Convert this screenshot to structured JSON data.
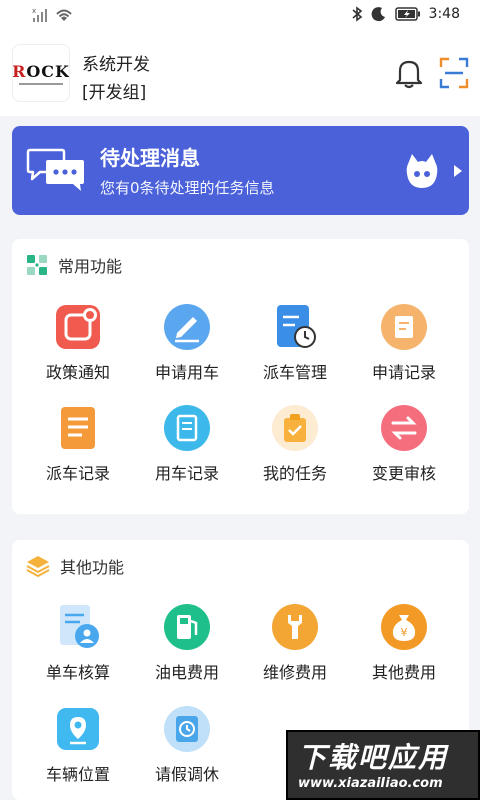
{
  "status_bar": {
    "time": "3:48",
    "icons": [
      "no-sim-icon",
      "wifi-icon",
      "bluetooth-icon",
      "moon-icon",
      "battery-icon"
    ]
  },
  "header": {
    "avatar_logo_text": "ROCK",
    "user_name": "系统开发",
    "user_group": "[开发组]",
    "icons": [
      "bell-icon",
      "scan-icon"
    ]
  },
  "banner": {
    "title": "待处理消息",
    "subtitle": "您有0条待处理的任务信息",
    "color": "#4a61d9"
  },
  "common": {
    "title": "常用功能",
    "items": [
      {
        "label": "政策通知",
        "icon": "policy-notice-icon",
        "color": "#f05a4f"
      },
      {
        "label": "申请用车",
        "icon": "apply-car-icon",
        "color": "#5aa7f0"
      },
      {
        "label": "派车管理",
        "icon": "dispatch-manage-icon",
        "color": "#3a8ee6"
      },
      {
        "label": "申请记录",
        "icon": "apply-record-icon",
        "color": "#f6b36b"
      },
      {
        "label": "派车记录",
        "icon": "dispatch-record-icon",
        "color": "#f59a3a"
      },
      {
        "label": "用车记录",
        "icon": "car-record-icon",
        "color": "#3db8ea"
      },
      {
        "label": "我的任务",
        "icon": "my-task-icon",
        "color": "#f7b13c"
      },
      {
        "label": "变更审核",
        "icon": "change-review-icon",
        "color": "#f56e7e"
      }
    ]
  },
  "other": {
    "title": "其他功能",
    "items": [
      {
        "label": "单车核算",
        "icon": "accounting-icon",
        "color": "#49a7ee"
      },
      {
        "label": "油电费用",
        "icon": "fuel-cost-icon",
        "color": "#1fbf8c"
      },
      {
        "label": "维修费用",
        "icon": "repair-cost-icon",
        "color": "#f3a634"
      },
      {
        "label": "其他费用",
        "icon": "other-cost-icon",
        "color": "#f39a26"
      },
      {
        "label": "车辆位置",
        "icon": "location-icon",
        "color": "#3fb9ef"
      },
      {
        "label": "请假调休",
        "icon": "leave-icon",
        "color": "#4aa6ea"
      }
    ]
  },
  "watermark": {
    "main": "下载吧应用",
    "url": "www.xiazaiIiao.com"
  }
}
